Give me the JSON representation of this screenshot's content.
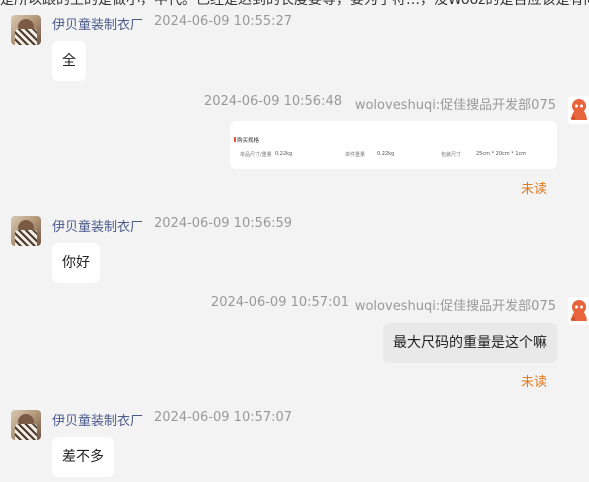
{
  "top_clipped_text": "是所以跟的上的是做小，中代。已经是达到的长度要等，要为了符…，没Wooz的是否应该是有问题，但是想要的支付方式，确定好可是，可能…",
  "messages": [
    {
      "side": "left",
      "sender": "伊贝童装制衣厂",
      "time": "2024-06-09 10:55:27",
      "text": "全"
    },
    {
      "side": "right",
      "sender": "woloveshuqi:促佳搜品开发部075",
      "time": "2024-06-09 10:56:48",
      "card": {
        "title": "购买规格",
        "fields": [
          {
            "label": "单品尺寸/重量",
            "value": "0.22kg"
          },
          {
            "label": "单件重量",
            "value": "0.22kg"
          },
          {
            "label": "包装尺寸",
            "value": "25cm * 20cm * 1cm"
          }
        ]
      },
      "status": "未读"
    },
    {
      "side": "left",
      "sender": "伊贝童装制衣厂",
      "time": "2024-06-09 10:56:59",
      "text": "你好"
    },
    {
      "side": "right",
      "sender": "woloveshuqi:促佳搜品开发部075",
      "time": "2024-06-09 10:57:01",
      "text": "最大尺码的重量是这个嘛",
      "status": "未读"
    },
    {
      "side": "left",
      "sender": "伊贝童装制衣厂",
      "time": "2024-06-09 10:57:07",
      "text": "差不多"
    }
  ],
  "icons": {
    "left_avatar": "seller-avatar-icon",
    "right_avatar": "robot-avatar-icon"
  },
  "colors": {
    "background": "#f3f3f3",
    "sender_name": "#4a5a8a",
    "timestamp": "#999999",
    "unread": "#e07a1f",
    "my_bubble": "#e9e9e9",
    "their_bubble": "#ffffff",
    "robot": "#e8643c"
  }
}
